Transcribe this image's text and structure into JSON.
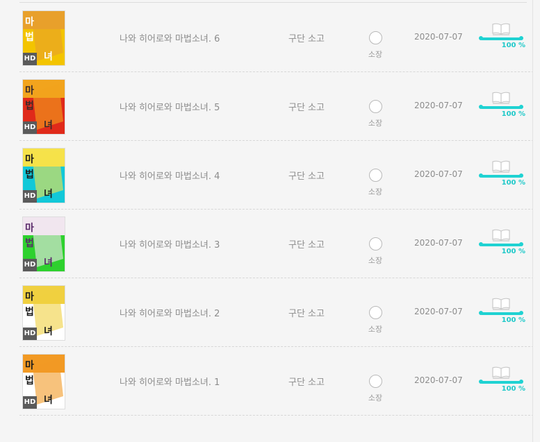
{
  "books": [
    {
      "title": "나와 히어로와 마법소녀. 6",
      "status": "구단 소고",
      "ownership_label": "소장",
      "date": "2020-07-07",
      "progress_text": "100 %",
      "progress": 1.0,
      "badge": "HD",
      "cover_colors": [
        "#f3c400",
        "#e8a02c",
        "#ffffff"
      ]
    },
    {
      "title": "나와 히어로와 마법소녀. 5",
      "status": "구단 소고",
      "ownership_label": "소장",
      "date": "2020-07-07",
      "progress_text": "100 %",
      "progress": 1.0,
      "badge": "HD",
      "cover_colors": [
        "#e02a1a",
        "#f2a41d",
        "#3a2a2a"
      ]
    },
    {
      "title": "나와 히어로와 마법소녀. 4",
      "status": "구단 소고",
      "ownership_label": "소장",
      "date": "2020-07-07",
      "progress_text": "100 %",
      "progress": 1.0,
      "badge": "HD",
      "cover_colors": [
        "#12c8d8",
        "#f6e24a",
        "#1b1b1b"
      ]
    },
    {
      "title": "나와 히어로와 마법소녀. 3",
      "status": "구단 소고",
      "ownership_label": "소장",
      "date": "2020-07-07",
      "progress_text": "100 %",
      "progress": 1.0,
      "badge": "HD",
      "cover_colors": [
        "#2ed12e",
        "#f1e6ef",
        "#5a2a6a"
      ]
    },
    {
      "title": "나와 히어로와 마법소녀. 2",
      "status": "구단 소고",
      "ownership_label": "소장",
      "date": "2020-07-07",
      "progress_text": "100 %",
      "progress": 1.0,
      "badge": "HD",
      "cover_colors": [
        "#ffffff",
        "#f0d040",
        "#1b1b1b"
      ]
    },
    {
      "title": "나와 히어로와 마법소녀. 1",
      "status": "구단 소고",
      "ownership_label": "소장",
      "date": "2020-07-07",
      "progress_text": "100 %",
      "progress": 1.0,
      "badge": "HD",
      "cover_colors": [
        "#ffffff",
        "#f29a24",
        "#1b1b1b"
      ]
    }
  ],
  "colors": {
    "accent": "#1fd2d2",
    "text_muted": "#8c8c8c",
    "background": "#f5f5f5"
  },
  "icons": {
    "reader": "open-book-icon",
    "ownership": "radio-circle-icon"
  }
}
